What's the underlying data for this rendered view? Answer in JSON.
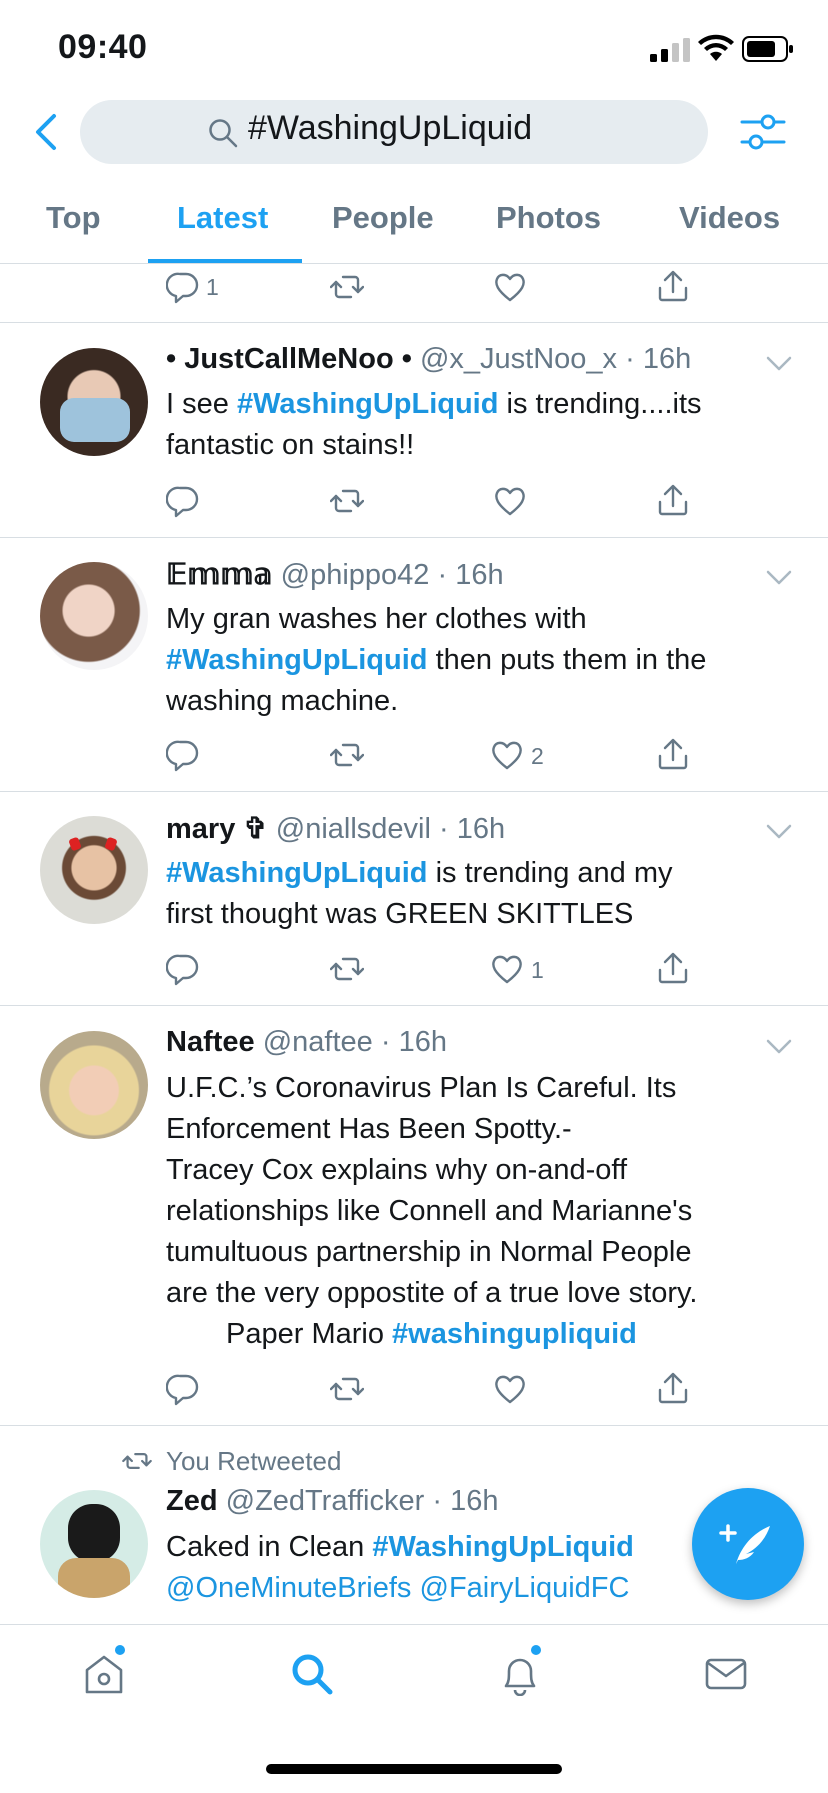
{
  "status_bar": {
    "time": "09:40"
  },
  "search": {
    "query": "#WashingUpLiquid"
  },
  "tabs": [
    "Top",
    "Latest",
    "People",
    "Photos",
    "Videos"
  ],
  "partial_tweet": {
    "reply_count": "1"
  },
  "tweets": [
    {
      "display_name": "• JustCallMeNoo •",
      "handle": "@x_JustNoo_x",
      "time": "16h",
      "text_1": "I see ",
      "hashtag": "#WashingUpLiquid",
      "text_2": " is trending....its",
      "text_3": "fantastic on stains!!",
      "likes": ""
    },
    {
      "display_name": "𝔼𝕞𝕞𝕒",
      "handle": "@phippo42",
      "time": "16h",
      "text_1": "My gran washes her clothes with",
      "hashtag": "#WashingUpLiquid",
      "text_2": " then puts them in the",
      "text_3": "washing machine.",
      "likes": "2"
    },
    {
      "display_name": "mary ✞",
      "handle": "@niallsdevil",
      "time": "16h",
      "hashtag": "#WashingUpLiquid",
      "text_1": " is trending and my",
      "text_2": "first thought was GREEN SKITTLES",
      "likes": "1"
    },
    {
      "display_name": "Naftee",
      "handle": "@naftee",
      "time": "16h",
      "line_1": "U.F.C.’s Coronavirus Plan Is Careful. Its",
      "line_2": "Enforcement Has Been Spotty.-",
      "line_3": "Tracey Cox explains why on-and-off",
      "line_4": "relationships like Connell and Marianne's",
      "line_5": "tumultuous partnership in Normal People",
      "line_6": "are the very oppostite of a true love story.",
      "line_7": "Paper Mario ",
      "hashtag": "#washingupliquid",
      "likes": ""
    },
    {
      "retweet_label": "You Retweeted",
      "display_name": "Zed",
      "handle": "@ZedTrafficker",
      "time": "16h",
      "text_1": "Caked in Clean ",
      "hashtag": "#WashingUpLiquid",
      "mention_1": "@OneMinuteBriefs",
      "mention_2": "@FairyLiquidFC"
    }
  ],
  "colors": {
    "accent": "#1da1f2",
    "muted": "#657786",
    "hashtag": "#1b95e0"
  },
  "icons": [
    "back-arrow-icon",
    "search-icon",
    "filter-icon",
    "reply-icon",
    "retweet-icon",
    "like-icon",
    "share-icon",
    "chevron-down-icon",
    "compose-icon",
    "home-icon",
    "explore-icon",
    "notifications-icon",
    "messages-icon"
  ]
}
